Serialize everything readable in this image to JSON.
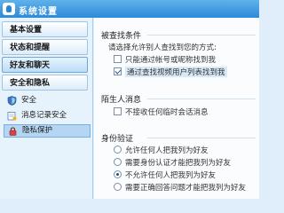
{
  "window": {
    "title": "系统设置"
  },
  "sidebar": {
    "categories": [
      {
        "label": "基本设置"
      },
      {
        "label": "状态和提醒"
      },
      {
        "label": "好友和聊天"
      },
      {
        "label": "安全和隐私"
      }
    ],
    "sub_items": [
      {
        "label": "安全",
        "icon": "shield-icon"
      },
      {
        "label": "消息记录安全",
        "icon": "message-icon"
      },
      {
        "label": "隐私保护",
        "icon": "privacy-icon",
        "selected": true
      }
    ]
  },
  "main": {
    "search_section": {
      "title": "被查找条件",
      "prompt": "请选择允许别人查找到您的方式:",
      "options": [
        {
          "label": "只能通过帐号或昵称找到我",
          "checked": false
        },
        {
          "label": "通过查找视频用户列表找到我",
          "checked": true
        }
      ]
    },
    "stranger_section": {
      "title": "陌生人消息",
      "options": [
        {
          "label": "不接收任何临时会话消息",
          "checked": false
        }
      ]
    },
    "verify_section": {
      "title": "身份验证",
      "options": [
        {
          "label": "允许任何人把我列为好友",
          "checked": false
        },
        {
          "label": "需要身份认证才能把我列为好友",
          "checked": false
        },
        {
          "label": "不允许任何人把我列为好友",
          "checked": true
        },
        {
          "label": "需要正确回答问题才能把我列为好友",
          "checked": false
        }
      ]
    }
  },
  "colors": {
    "titlebar": "#2d8ad8",
    "sidebar_bg": "#e6f2fc",
    "selected": "#b5d6f3"
  }
}
